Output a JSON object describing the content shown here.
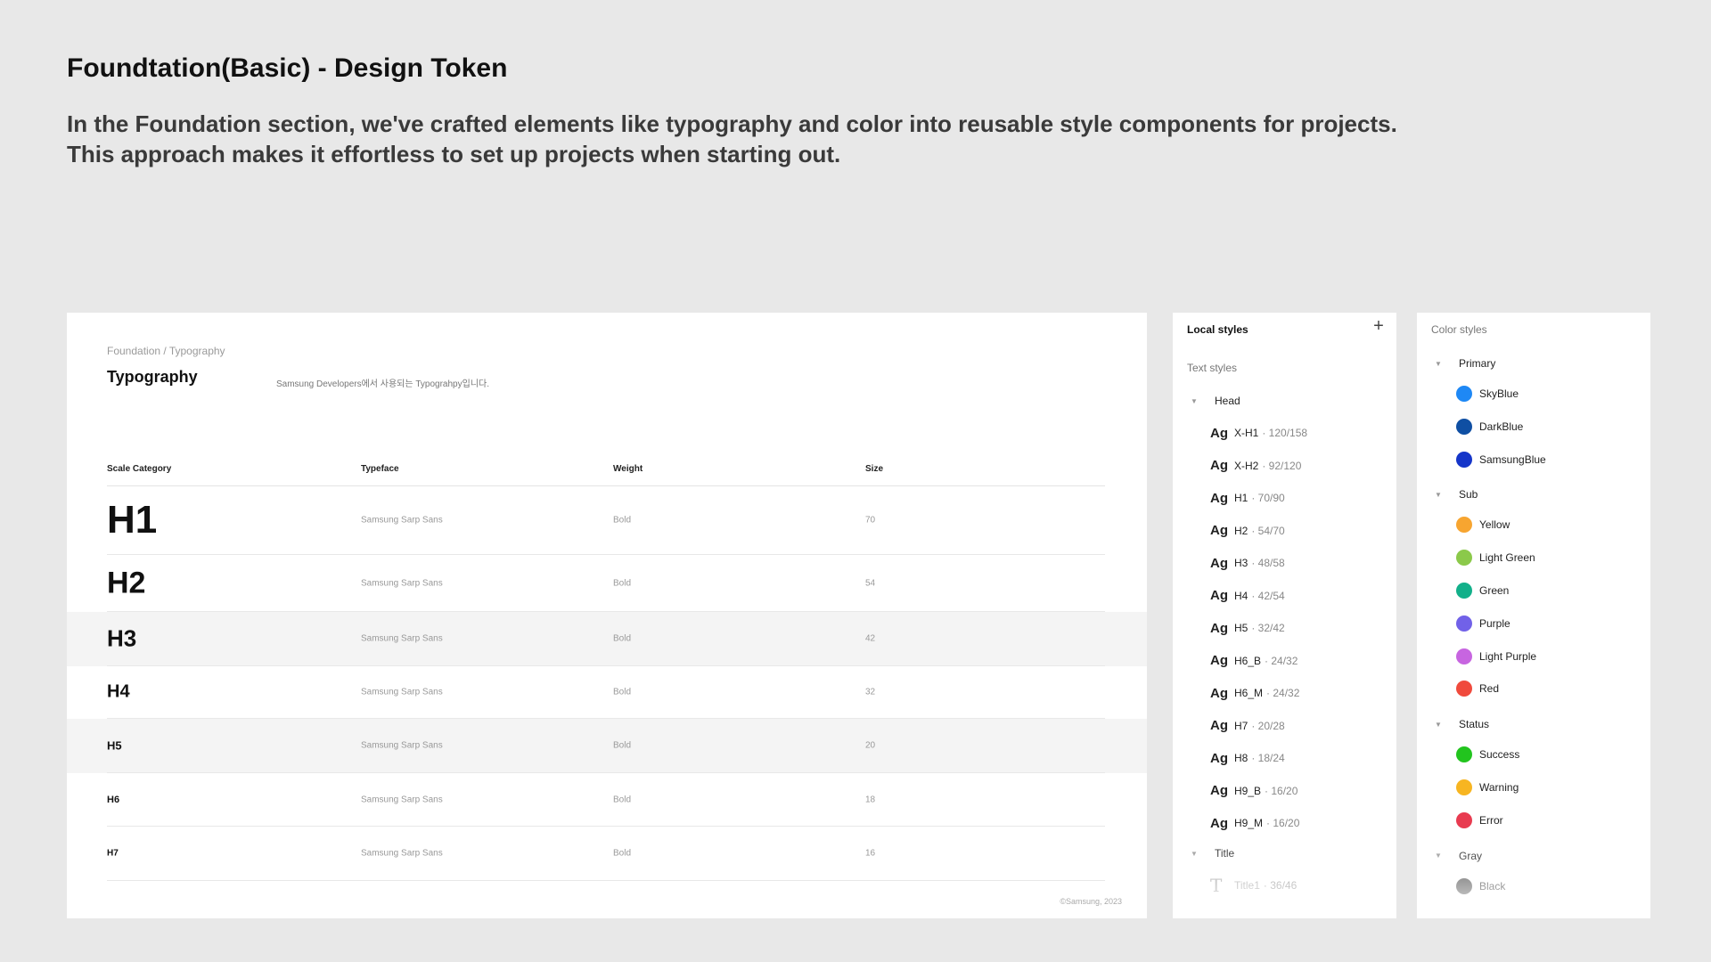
{
  "header": {
    "title": "Foundtation(Basic) - Design Token",
    "description_line1": "In the Foundation section, we've crafted elements like typography and color into reusable style components for projects.",
    "description_line2": "This approach makes it effortless to set up projects when starting out."
  },
  "typography": {
    "breadcrumb": "Foundation / Typography",
    "heading": "Typography",
    "subtitle": "Samsung Developers에서 사용되는 Typograhpy입니다.",
    "columns": [
      "Scale Category",
      "Typeface",
      "Weight",
      "Size"
    ],
    "rows": [
      {
        "label": "H1",
        "typeface": "Samsung Sarp Sans",
        "weight": "Bold",
        "size": "70"
      },
      {
        "label": "H2",
        "typeface": "Samsung Sarp Sans",
        "weight": "Bold",
        "size": "54"
      },
      {
        "label": "H3",
        "typeface": "Samsung Sarp Sans",
        "weight": "Bold",
        "size": "42"
      },
      {
        "label": "H4",
        "typeface": "Samsung Sarp Sans",
        "weight": "Bold",
        "size": "32"
      },
      {
        "label": "H5",
        "typeface": "Samsung Sarp Sans",
        "weight": "Bold",
        "size": "20"
      },
      {
        "label": "H6",
        "typeface": "Samsung Sarp Sans",
        "weight": "Bold",
        "size": "18"
      },
      {
        "label": "H7",
        "typeface": "Samsung Sarp Sans",
        "weight": "Bold",
        "size": "16"
      }
    ],
    "footer": "©Samsung, 2023"
  },
  "local_styles": {
    "title": "Local styles",
    "text_styles_label": "Text styles",
    "groups": {
      "head": "Head",
      "title": "Title"
    },
    "head_items": [
      {
        "name": "X-H1",
        "meta": "· 120/158"
      },
      {
        "name": "X-H2",
        "meta": "· 92/120"
      },
      {
        "name": "H1",
        "meta": "· 70/90"
      },
      {
        "name": "H2",
        "meta": "· 54/70"
      },
      {
        "name": "H3",
        "meta": "· 48/58"
      },
      {
        "name": "H4",
        "meta": "· 42/54"
      },
      {
        "name": "H5",
        "meta": "· 32/42"
      },
      {
        "name": "H6_B",
        "meta": "· 24/32"
      },
      {
        "name": "H6_M",
        "meta": "· 24/32"
      },
      {
        "name": "H7",
        "meta": "· 20/28"
      },
      {
        "name": "H8",
        "meta": "· 18/24"
      },
      {
        "name": "H9_B",
        "meta": "· 16/20"
      },
      {
        "name": "H9_M",
        "meta": "· 16/20"
      }
    ],
    "title_items": [
      {
        "name": "Title1",
        "meta": "· 36/46"
      }
    ],
    "icons": {
      "text_style": "Ag",
      "title_style": "T"
    }
  },
  "color_styles": {
    "title": "Color styles",
    "groups": [
      {
        "name": "Primary",
        "items": [
          {
            "name": "SkyBlue",
            "color": "#1e88f5"
          },
          {
            "name": "DarkBlue",
            "color": "#0f4fa3"
          },
          {
            "name": "SamsungBlue",
            "color": "#1535c9"
          }
        ]
      },
      {
        "name": "Sub",
        "items": [
          {
            "name": "Yellow",
            "color": "#f7a530"
          },
          {
            "name": "Light Green",
            "color": "#8bc94a"
          },
          {
            "name": "Green",
            "color": "#12b08a"
          },
          {
            "name": "Purple",
            "color": "#7161e8"
          },
          {
            "name": "Light Purple",
            "color": "#c765e0"
          },
          {
            "name": "Red",
            "color": "#f04a3c"
          }
        ]
      },
      {
        "name": "Status",
        "items": [
          {
            "name": "Success",
            "color": "#22c41e"
          },
          {
            "name": "Warning",
            "color": "#f7b521"
          },
          {
            "name": "Error",
            "color": "#e83b50"
          }
        ]
      },
      {
        "name": "Gray",
        "items": [
          {
            "name": "Black",
            "color": "#3a3a3a"
          }
        ]
      }
    ]
  }
}
